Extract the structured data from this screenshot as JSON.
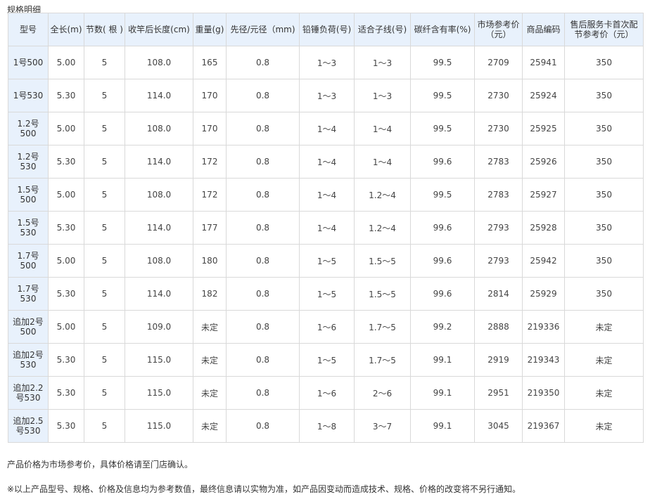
{
  "caption": "规格明细",
  "headers": [
    "型号",
    "全长(m)",
    "节数( 根 )",
    "收竿后长度(cm)",
    "重量(g)",
    "先径/元径（mm)",
    "铅锤负荷(号)",
    "适合子线(号)",
    "碳纤含有率(%)",
    "市场参考价（元）",
    "商品编码",
    "售后服务卡首次配节参考价（元）"
  ],
  "rows": [
    [
      "1号500",
      "5.00",
      "5",
      "108.0",
      "165",
      "0.8",
      "1～3",
      "1～3",
      "99.5",
      "2709",
      "25941",
      "350"
    ],
    [
      "1号530",
      "5.30",
      "5",
      "114.0",
      "170",
      "0.8",
      "1～3",
      "1～3",
      "99.5",
      "2730",
      "25924",
      "350"
    ],
    [
      "1.2号500",
      "5.00",
      "5",
      "108.0",
      "170",
      "0.8",
      "1～4",
      "1～4",
      "99.5",
      "2730",
      "25925",
      "350"
    ],
    [
      "1.2号530",
      "5.30",
      "5",
      "114.0",
      "172",
      "0.8",
      "1～4",
      "1～4",
      "99.6",
      "2783",
      "25926",
      "350"
    ],
    [
      "1.5号500",
      "5.00",
      "5",
      "108.0",
      "172",
      "0.8",
      "1～4",
      "1.2～4",
      "99.5",
      "2783",
      "25927",
      "350"
    ],
    [
      "1.5号530",
      "5.30",
      "5",
      "114.0",
      "177",
      "0.8",
      "1～4",
      "1.2～4",
      "99.6",
      "2793",
      "25928",
      "350"
    ],
    [
      "1.7号500",
      "5.00",
      "5",
      "108.0",
      "180",
      "0.8",
      "1～5",
      "1.5～5",
      "99.6",
      "2793",
      "25942",
      "350"
    ],
    [
      "1.7号530",
      "5.30",
      "5",
      "114.0",
      "182",
      "0.8",
      "1～5",
      "1.5～5",
      "99.6",
      "2814",
      "25929",
      "350"
    ],
    [
      "追加2号500",
      "5.00",
      "5",
      "109.0",
      "未定",
      "0.8",
      "1～6",
      "1.7～5",
      "99.2",
      "2888",
      "219336",
      "未定"
    ],
    [
      "追加2号530",
      "5.30",
      "5",
      "115.0",
      "未定",
      "0.8",
      "1～5",
      "1.7～5",
      "99.1",
      "2919",
      "219343",
      "未定"
    ],
    [
      "追加2.2号530",
      "5.30",
      "5",
      "115.0",
      "未定",
      "0.8",
      "1～6",
      "2～6",
      "99.1",
      "2951",
      "219350",
      "未定"
    ],
    [
      "追加2.5号530",
      "5.30",
      "5",
      "115.0",
      "未定",
      "0.8",
      "1～8",
      "3～7",
      "99.1",
      "3045",
      "219367",
      "未定"
    ]
  ],
  "note_price": "产品价格为市场参考价，具体价格请至门店确认。",
  "note_disclaimer": "※以上产品型号、规格、价格及信息均为参考数值，最终信息请以实物为准，如产品因变动而造成技术、规格、价格的改变将不另行通知。"
}
